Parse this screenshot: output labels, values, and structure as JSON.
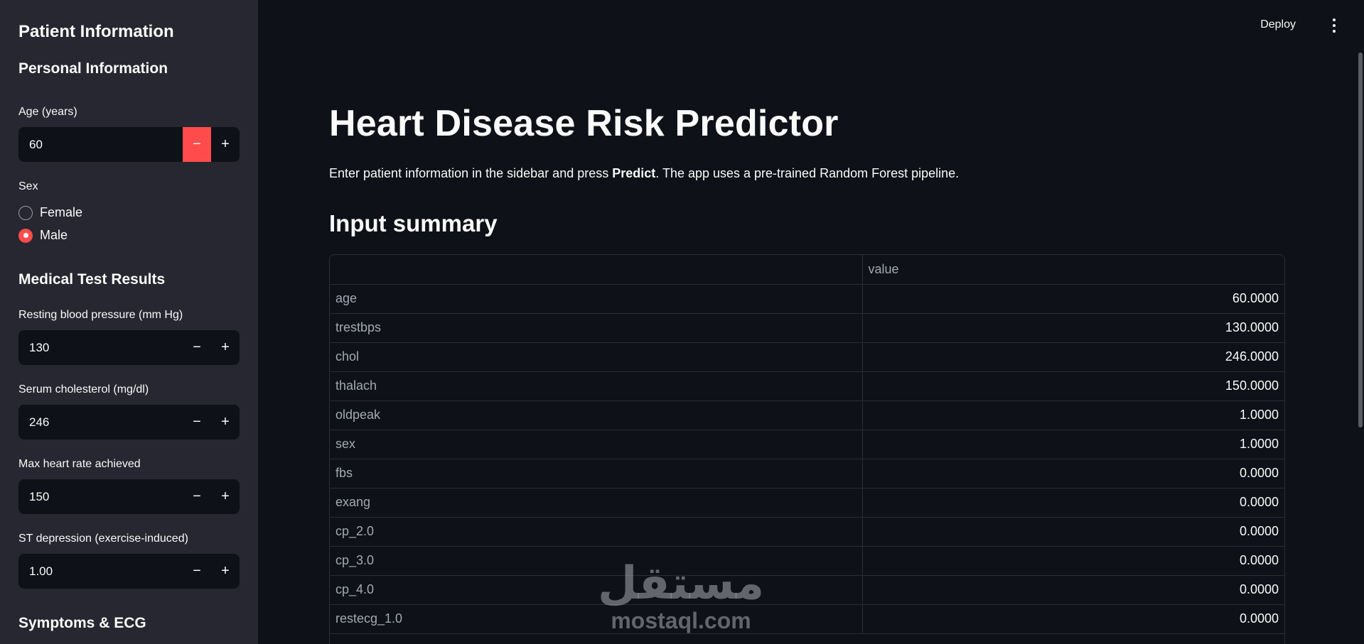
{
  "sidebar": {
    "title": "Patient Information",
    "personal_section": "Personal Information",
    "age": {
      "label": "Age (years)",
      "value": "60",
      "minus": "−",
      "plus": "+"
    },
    "sex": {
      "label": "Sex",
      "options": [
        "Female",
        "Male"
      ],
      "selected": "Male"
    },
    "medical_section": "Medical Test Results",
    "bp": {
      "label": "Resting blood pressure (mm Hg)",
      "value": "130",
      "minus": "−",
      "plus": "+"
    },
    "chol": {
      "label": "Serum cholesterol (mg/dl)",
      "value": "246",
      "minus": "−",
      "plus": "+"
    },
    "hr": {
      "label": "Max heart rate achieved",
      "value": "150",
      "minus": "−",
      "plus": "+"
    },
    "st": {
      "label": "ST depression (exercise-induced)",
      "value": "1.00",
      "minus": "−",
      "plus": "+"
    },
    "symptoms_section": "Symptoms & ECG"
  },
  "topbar": {
    "deploy": "Deploy"
  },
  "main": {
    "title": "Heart Disease Risk Predictor",
    "intro_before": "Enter patient information in the sidebar and press ",
    "intro_bold": "Predict",
    "intro_after": ". The app uses a pre-trained Random Forest pipeline.",
    "summary_header": "Input summary",
    "table": {
      "column": "value",
      "rows": [
        [
          "age",
          "60.0000"
        ],
        [
          "trestbps",
          "130.0000"
        ],
        [
          "chol",
          "246.0000"
        ],
        [
          "thalach",
          "150.0000"
        ],
        [
          "oldpeak",
          "1.0000"
        ],
        [
          "sex",
          "1.0000"
        ],
        [
          "fbs",
          "0.0000"
        ],
        [
          "exang",
          "0.0000"
        ],
        [
          "cp_2.0",
          "0.0000"
        ],
        [
          "cp_3.0",
          "0.0000"
        ],
        [
          "cp_4.0",
          "0.0000"
        ],
        [
          "restecg_1.0",
          "0.0000"
        ]
      ]
    }
  },
  "watermark": {
    "arabic": "مستقل",
    "latin": "mostaql.com"
  },
  "colors": {
    "accent": "#ff4b4b",
    "sidebar_bg": "#262730",
    "main_bg": "#0e1117"
  }
}
